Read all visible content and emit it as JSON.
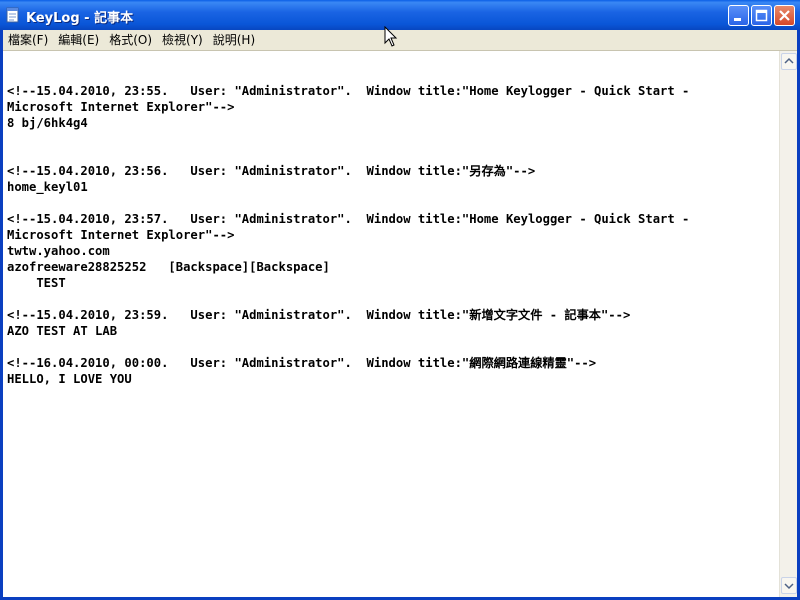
{
  "window": {
    "title": "KeyLog - 記事本",
    "icon": "notepad-icon"
  },
  "menu": [
    {
      "label": "檔案(F)"
    },
    {
      "label": "編輯(E)"
    },
    {
      "label": "格式(O)"
    },
    {
      "label": "檢視(Y)"
    },
    {
      "label": "說明(H)"
    }
  ],
  "content": {
    "lines": [
      "",
      "",
      "<!--15.04.2010, 23:55.   User: \"Administrator\".  Window title:\"Home Keylogger - Quick Start -",
      "Microsoft Internet Explorer\"-->",
      "8 bj/6hk4g4",
      "",
      "",
      "<!--15.04.2010, 23:56.   User: \"Administrator\".  Window title:\"另存為\"-->",
      "home_keyl01",
      "",
      "<!--15.04.2010, 23:57.   User: \"Administrator\".  Window title:\"Home Keylogger - Quick Start -",
      "Microsoft Internet Explorer\"-->",
      "twtw.yahoo.com",
      "azofreeware28825252   [Backspace][Backspace]",
      "    TEST",
      "",
      "<!--15.04.2010, 23:59.   User: \"Administrator\".  Window title:\"新增文字文件 - 記事本\"-->",
      "AZO TEST AT LAB",
      "",
      "<!--16.04.2010, 00:00.   User: \"Administrator\".  Window title:\"網際網路連線精靈\"-->",
      "HELLO, I LOVE YOU"
    ]
  },
  "colors": {
    "titlebar": "#0a5ee6",
    "menubar": "#ece9d8",
    "text": "#000000"
  }
}
